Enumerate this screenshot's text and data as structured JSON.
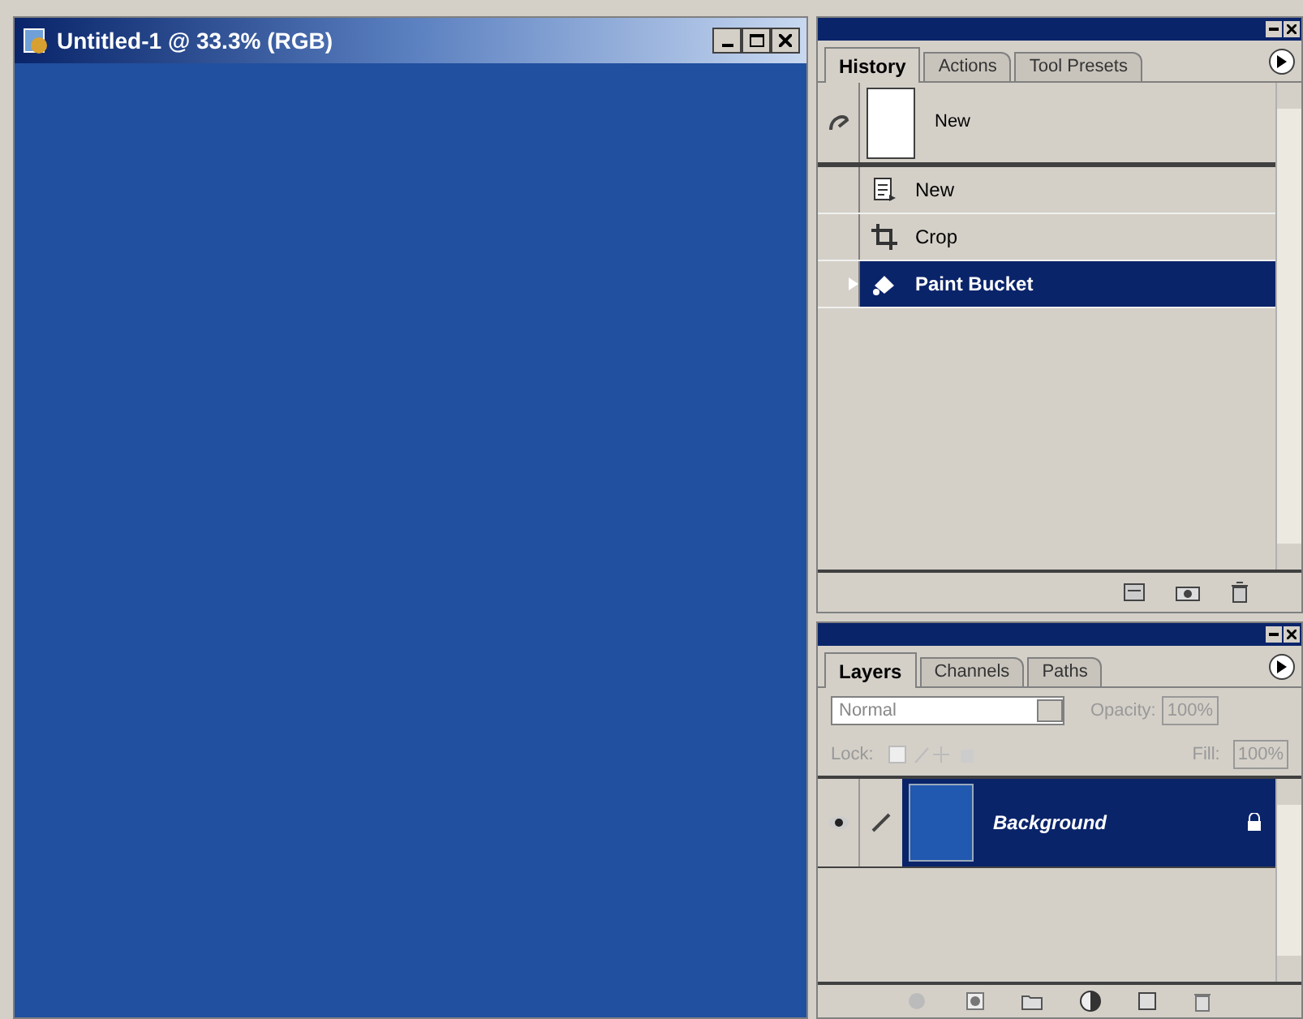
{
  "document": {
    "title": "Untitled-1 @ 33.3% (RGB)"
  },
  "history_panel": {
    "tabs": [
      {
        "label": "History",
        "selected": true
      },
      {
        "label": "Actions",
        "selected": false
      },
      {
        "label": "Tool Presets",
        "selected": false
      }
    ],
    "snapshot": {
      "label": "New"
    },
    "steps": [
      {
        "label": "New",
        "kind": "document",
        "selected": false
      },
      {
        "label": "Crop",
        "kind": "crop",
        "selected": false
      },
      {
        "label": "Paint Bucket",
        "kind": "bucket",
        "selected": true
      }
    ]
  },
  "layers_panel": {
    "tabs": [
      {
        "label": "Layers",
        "selected": true
      },
      {
        "label": "Channels",
        "selected": false
      },
      {
        "label": "Paths",
        "selected": false
      }
    ],
    "blend_mode": "Normal",
    "opacity_label": "Opacity:",
    "opacity": "100%",
    "lock_label": "Lock:",
    "fill_label": "Fill:",
    "fill": "100%",
    "layers": [
      {
        "name": "Background",
        "selected": true,
        "visible": true,
        "locked": true
      }
    ]
  }
}
